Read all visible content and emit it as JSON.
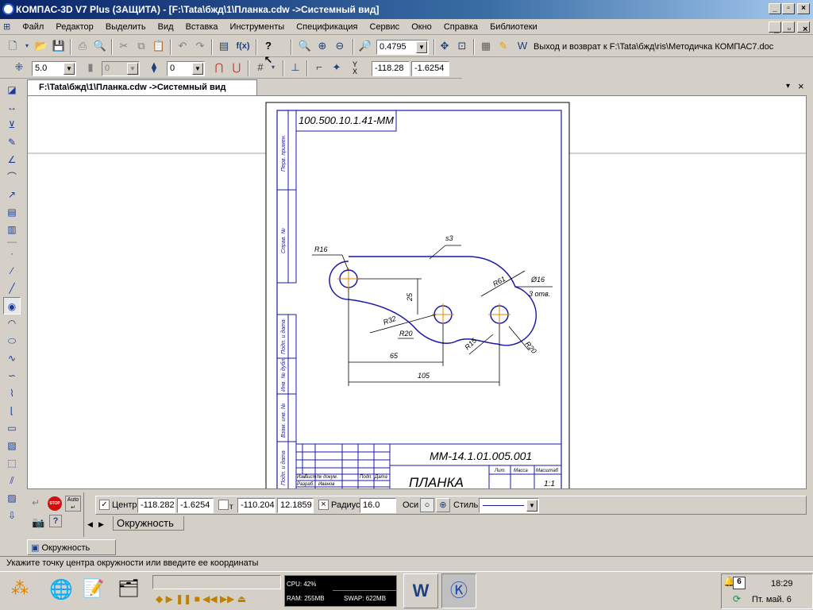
{
  "window": {
    "title": "КОМПАС-3D V7 Plus (ЗАЩИТА) - [F:\\Tata\\бжд\\1\\Планка.cdw ->Системный вид]",
    "min": "_",
    "max": "▫",
    "close": "×"
  },
  "menu": [
    "Файл",
    "Редактор",
    "Выделить",
    "Вид",
    "Вставка",
    "Инструменты",
    "Спецификация",
    "Сервис",
    "Окно",
    "Справка",
    "Библиотеки"
  ],
  "toolbar1": {
    "zoom_value": "0.4795",
    "link_text": "Выход и возврат к F:\\Tata\\бжд\\ris\\Методичка КОМПАС7.doc"
  },
  "toolbar2": {
    "step": "5.0",
    "layer": "0",
    "style": "0",
    "coord_x": "-118.28",
    "coord_y": "-1.6254"
  },
  "doc_tab": "F:\\Tata\\бжд\\1\\Планка.cdw ->Системный вид",
  "drawing": {
    "designation": "ММ-14.1.01.005.001",
    "title": "ПЛАНКА",
    "stamp_top": "100.500.10.1.41-ММ",
    "dims": {
      "r16": "R16",
      "s3": "s3",
      "r61": "R61",
      "d16": "Ø16",
      "holes": "3 отв.",
      "r32": "R32",
      "r20a": "R20",
      "r15": "R15",
      "r20b": "R20",
      "d25": "25",
      "d65": "65",
      "d105": "105"
    },
    "side_labels": [
      "Перв. примен.",
      "Справ. №",
      "Подп. и дата",
      "Инв. № дубл.",
      "Взам. инв. №",
      "Подп. и дата"
    ],
    "stamp_cells": {
      "lit": "Лит.",
      "mass": "Масса",
      "scale": "Масштаб",
      "scale_val": "1:1",
      "developer": "Разраб.",
      "developer_name": "Иванов",
      "izm": "Изм.",
      "list": "Лист",
      "doc": "№ докум.",
      "sign": "Подп.",
      "date": "Дата"
    }
  },
  "panel": {
    "center_label": "Центр",
    "center_x": "-118.282",
    "center_y": "-1.6254",
    "t_label": "т",
    "t_x": "-110.204",
    "t_y": "12.1859",
    "radius_label": "Радиус",
    "radius": "16.0",
    "axes_label": "Оси",
    "style_label": "Стиль",
    "tab": "Окружность",
    "auto_label": "Auto",
    "stop_label": "STOP"
  },
  "bottom_tab": "Окружность",
  "status": "Укажите точку центра окружности или введите ее координаты",
  "taskbar": {
    "cpu": "CPU: 42%",
    "ram": "RAM: 255MB",
    "swap": "SWAP: 622MB",
    "time": "18:29",
    "date": "Пт. май. 6",
    "tray_badge": "6"
  },
  "colors": {
    "title_start": "#0a246a",
    "drawing_blue": "#1a1aa6",
    "accent_orange": "#e08a00"
  }
}
